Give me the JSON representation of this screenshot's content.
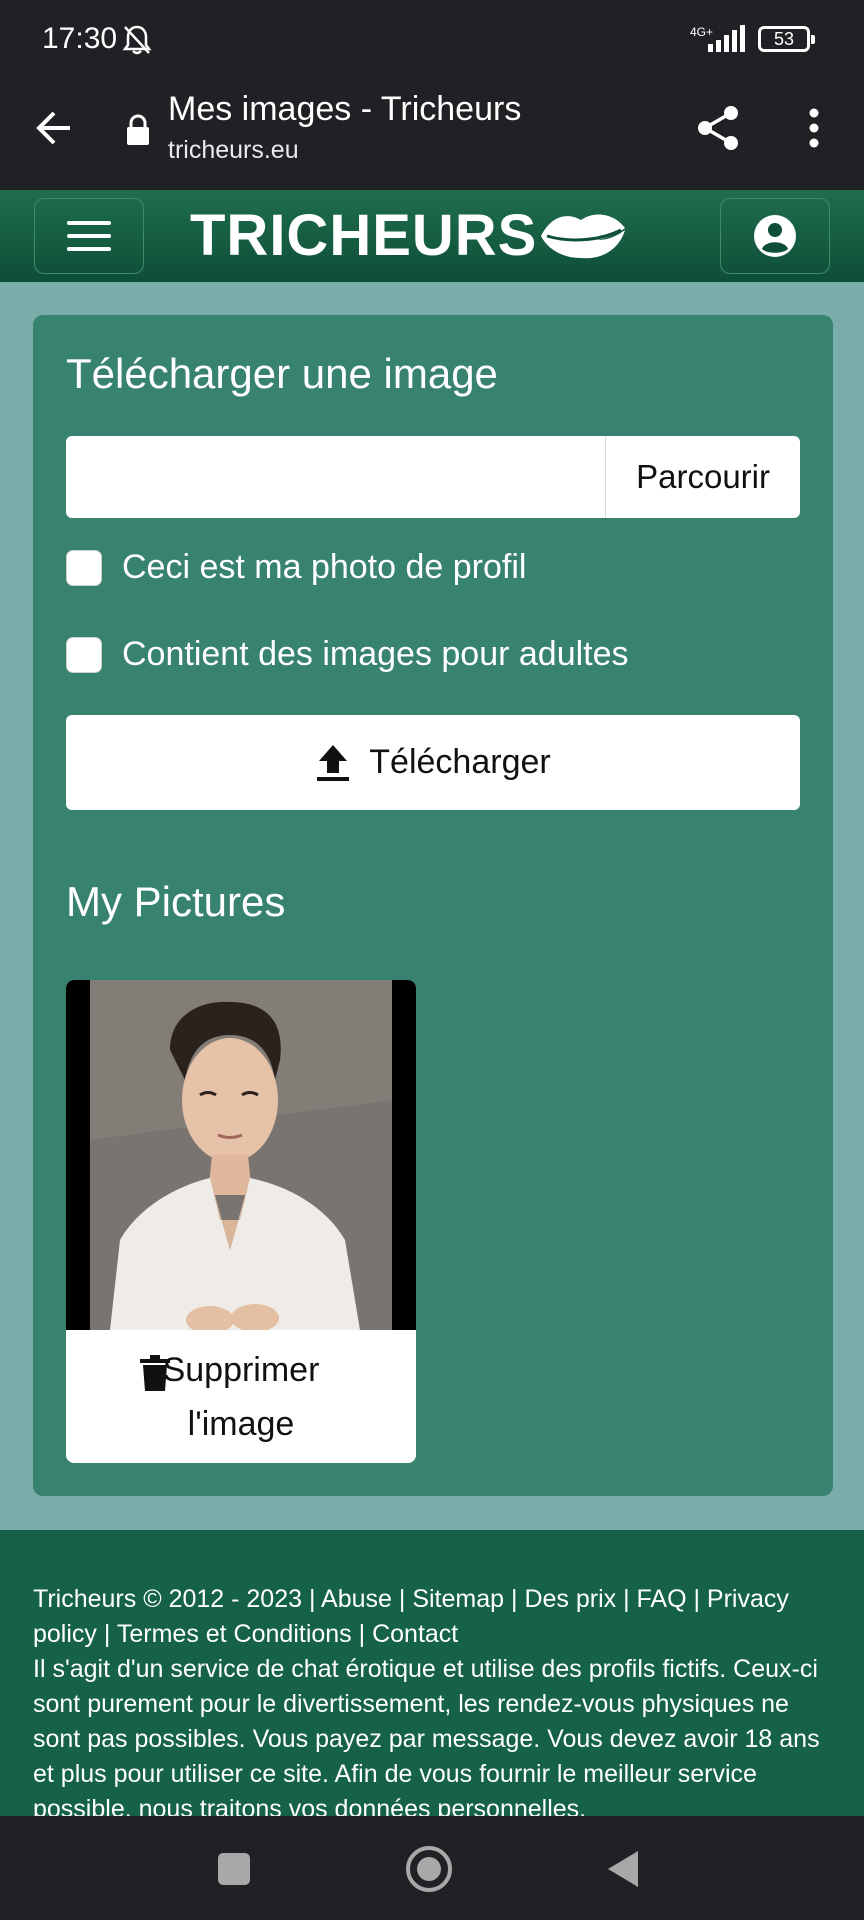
{
  "status_bar": {
    "time": "17:30",
    "network": "4G+",
    "battery": "53"
  },
  "browser": {
    "title": "Mes images - Tricheurs",
    "url": "tricheurs.eu"
  },
  "header": {
    "logo_text": "TRICHEURS"
  },
  "upload": {
    "heading": "Télécharger une image",
    "browse_label": "Parcourir",
    "checkbox_profile": "Ceci est ma photo de profil",
    "checkbox_adult": "Contient des images pour adultes",
    "submit_label": "Télécharger"
  },
  "pictures": {
    "heading": "My Pictures",
    "items": [
      {
        "delete_label": "Supprimer l'image"
      }
    ]
  },
  "footer": {
    "copyright": "Tricheurs © 2012 - 2023",
    "links": [
      "Abuse",
      "Sitemap",
      "Des prix",
      "FAQ",
      "Privacy policy",
      "Termes et Conditions",
      "Contact"
    ],
    "disclaimer": "Il s'agit d'un service de chat érotique et utilise des profils fictifs. Ceux-ci sont purement pour le divertissement, les rendez-vous physiques ne sont pas possibles. Vous payez par message. Vous devez avoir 18 ans et plus pour utiliser ce site. Afin de vous fournir le meilleur service possible, nous traitons vos données personnelles."
  },
  "colors": {
    "header_green": "#156249",
    "card_green": "#388270",
    "page_bg": "#7aada9"
  }
}
